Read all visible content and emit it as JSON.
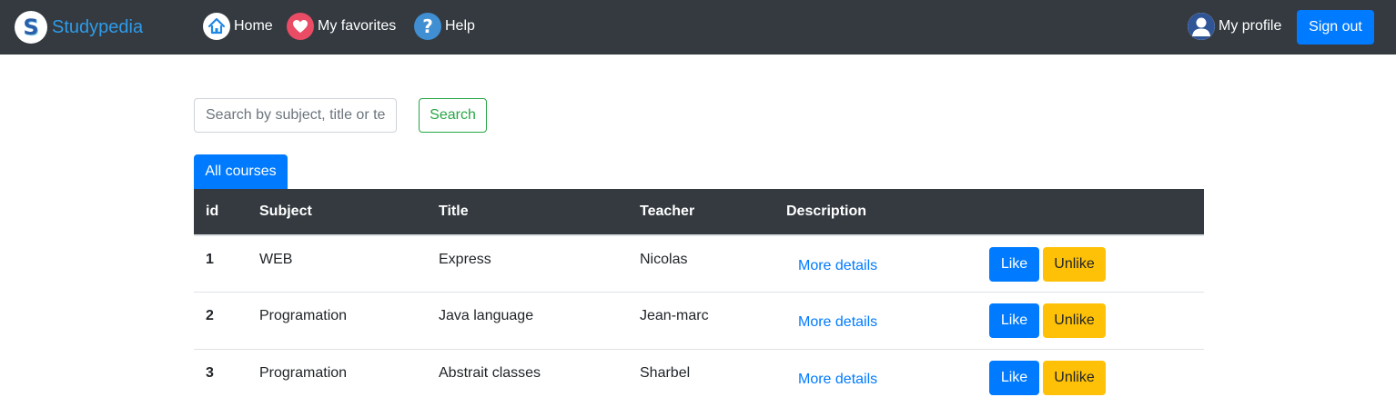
{
  "brand": {
    "name": "Studypedia",
    "logo_letter": "S",
    "logo_icon": "studypedia-logo"
  },
  "nav": {
    "home": {
      "label": "Home",
      "icon": "home-icon"
    },
    "favorites": {
      "label": "My favorites",
      "icon": "heart-icon"
    },
    "help": {
      "label": "Help",
      "icon": "help-icon",
      "glyph": "?"
    },
    "profile": {
      "label": "My profile",
      "icon": "user-avatar-icon"
    },
    "signout": {
      "label": "Sign out"
    }
  },
  "search": {
    "placeholder": "Search by subject, title or teacher",
    "value": "",
    "button_label": "Search"
  },
  "tab": {
    "label": "All courses"
  },
  "table": {
    "headers": {
      "id": "id",
      "subject": "Subject",
      "title": "Title",
      "teacher": "Teacher",
      "description": "Description"
    },
    "rows": [
      {
        "id": "1",
        "subject": "WEB",
        "title": "Express",
        "teacher": "Nicolas",
        "details": "More details",
        "like": "Like",
        "unlike": "Unlike"
      },
      {
        "id": "2",
        "subject": "Programation",
        "title": "Java language",
        "teacher": "Jean-marc",
        "details": "More details",
        "like": "Like",
        "unlike": "Unlike"
      },
      {
        "id": "3",
        "subject": "Programation",
        "title": "Abstrait classes",
        "teacher": "Sharbel",
        "details": "More details",
        "like": "Like",
        "unlike": "Unlike"
      }
    ]
  },
  "colors": {
    "navbar": "#343a40",
    "brand_text": "#2f9be9",
    "primary": "#007bff",
    "success": "#28a745",
    "warning": "#ffc107",
    "heart": "#e94c64"
  }
}
